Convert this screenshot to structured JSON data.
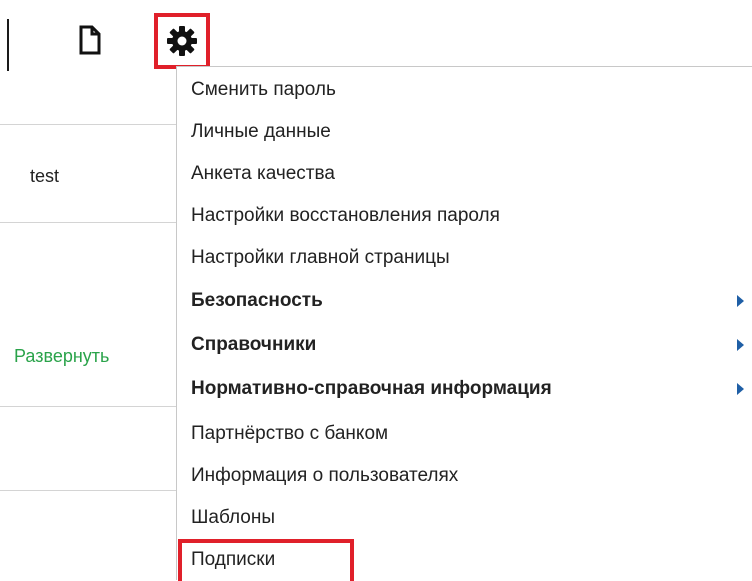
{
  "toolbar": {
    "document_icon": "document-icon",
    "settings_icon": "gear-icon",
    "highlight_color": "#e0202a"
  },
  "background": {
    "row_value": "test",
    "expand_link": "Развернуть",
    "expand_color": "#2aa34a"
  },
  "menu": {
    "items": [
      {
        "label": "Сменить пароль",
        "bold": false,
        "submenu": false
      },
      {
        "label": "Личные данные",
        "bold": false,
        "submenu": false
      },
      {
        "label": "Анкета качества",
        "bold": false,
        "submenu": false
      },
      {
        "label": "Настройки восстановления пароля",
        "bold": false,
        "submenu": false
      },
      {
        "label": "Настройки главной страницы",
        "bold": false,
        "submenu": false
      },
      {
        "label": "Безопасность",
        "bold": true,
        "submenu": true
      },
      {
        "label": "Справочники",
        "bold": true,
        "submenu": true
      },
      {
        "label": "Нормативно-справочная информация",
        "bold": true,
        "submenu": true
      },
      {
        "label": "Партнёрство с банком",
        "bold": false,
        "submenu": false
      },
      {
        "label": "Информация о пользователях",
        "bold": false,
        "submenu": false
      },
      {
        "label": "Шаблоны",
        "bold": false,
        "submenu": false
      },
      {
        "label": "Подписки",
        "bold": false,
        "submenu": false,
        "highlighted": true
      }
    ],
    "arrow_color": "#1f5fa6"
  }
}
